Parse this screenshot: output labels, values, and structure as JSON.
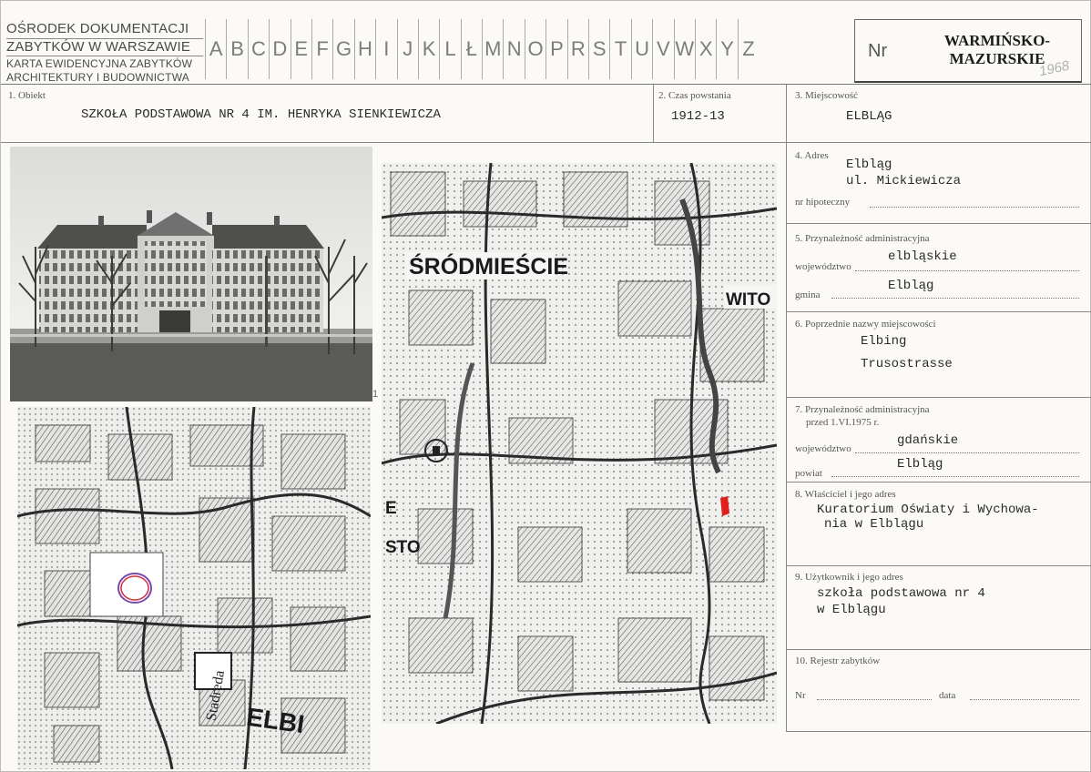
{
  "header": {
    "institution": [
      "OŚRODEK DOKUMENTACJI",
      "ZABYTKÓW W WARSZAWIE",
      "KARTA EWIDENCYJNA ZABYTKÓW",
      "ARCHITEKTURY I BUDOWNICTWA"
    ],
    "letters": [
      "A",
      "B",
      "C",
      "D",
      "E",
      "F",
      "G",
      "H",
      "I",
      "J",
      "K",
      "L",
      "Ł",
      "M",
      "N",
      "O",
      "P",
      "R",
      "S",
      "T",
      "U",
      "V",
      "W",
      "X",
      "Y",
      "Z"
    ],
    "nr_label": "Nr",
    "region_line1": "WARMIŃSKO-",
    "region_line2": "MAZURSKIE",
    "year_note": "1968"
  },
  "fields": {
    "f1_label": "1. Obiekt",
    "f1_value": "SZKOŁA PODSTAWOWA NR 4  IM. HENRYKA SIENKIEWICZA",
    "f2_label": "2. Czas powstania",
    "f2_value": "1912-13",
    "f3_label": "3. Miejscowość",
    "f3_value": "ELBLĄG",
    "f4_label": "4. Adres",
    "f4_value1": "Elbląg",
    "f4_value2": "ul. Mickiewicza",
    "f4_hip_label": "nr hipoteczny",
    "f5_label": "5. Przynależność administracyjna",
    "f5_woj_label": "województwo",
    "f5_woj_value": "elbląskie",
    "f5_gmina_label": "gmina",
    "f5_gmina_value": "Elbląg",
    "f6_label": "6. Poprzednie nazwy miejscowości",
    "f6_value1": "Elbing",
    "f6_value2": "Trusostrasse",
    "f7_label": "7. Przynależność administracyjna",
    "f7_label2": "przed 1.VI.1975 r.",
    "f7_woj_label": "województwo",
    "f7_woj_value": "gdańskie",
    "f7_powiat_label": "powiat",
    "f7_powiat_value": "Elbląg",
    "f8_label": "8. Właściciel i jego adres",
    "f8_value1": "Kuratorium Oświaty i Wychowa-",
    "f8_value2": "nia w Elblągu",
    "f9_label": "9. Użytkownik i jego adres",
    "f9_value1": "szkoła podstawowa nr 4",
    "f9_value2": "w Elblągu",
    "f10_label": "10. Rejestr zabytków",
    "f10_nr_label": "Nr",
    "f10_data_label": "data"
  },
  "maps": {
    "map2_label1": "ŚRÓDMIEŚCIE",
    "map2_label2": "WITO",
    "map2_label3": "E",
    "map2_label4": "STO",
    "map1_label1": "ELBI",
    "map1_label2": "Stadreda"
  },
  "photo_mark": "1"
}
